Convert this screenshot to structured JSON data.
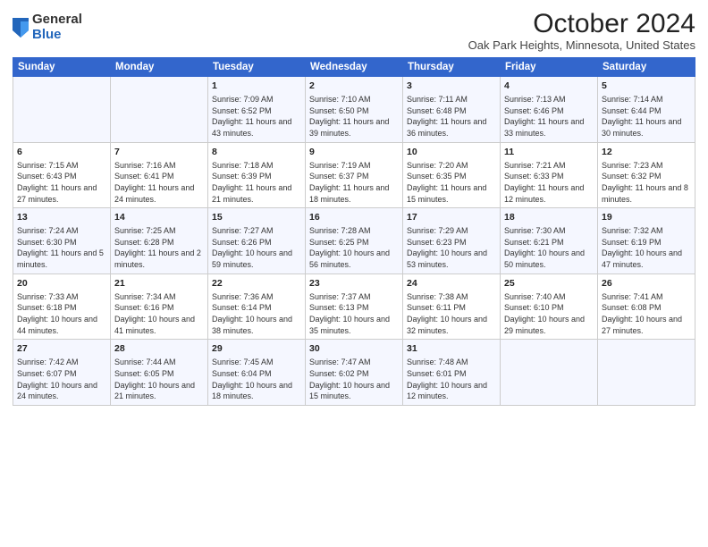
{
  "header": {
    "logo_general": "General",
    "logo_blue": "Blue",
    "title": "October 2024",
    "subtitle": "Oak Park Heights, Minnesota, United States"
  },
  "days_of_week": [
    "Sunday",
    "Monday",
    "Tuesday",
    "Wednesday",
    "Thursday",
    "Friday",
    "Saturday"
  ],
  "weeks": [
    [
      {
        "day": "",
        "data": ""
      },
      {
        "day": "",
        "data": ""
      },
      {
        "day": "1",
        "data": "Sunrise: 7:09 AM\nSunset: 6:52 PM\nDaylight: 11 hours and 43 minutes."
      },
      {
        "day": "2",
        "data": "Sunrise: 7:10 AM\nSunset: 6:50 PM\nDaylight: 11 hours and 39 minutes."
      },
      {
        "day": "3",
        "data": "Sunrise: 7:11 AM\nSunset: 6:48 PM\nDaylight: 11 hours and 36 minutes."
      },
      {
        "day": "4",
        "data": "Sunrise: 7:13 AM\nSunset: 6:46 PM\nDaylight: 11 hours and 33 minutes."
      },
      {
        "day": "5",
        "data": "Sunrise: 7:14 AM\nSunset: 6:44 PM\nDaylight: 11 hours and 30 minutes."
      }
    ],
    [
      {
        "day": "6",
        "data": "Sunrise: 7:15 AM\nSunset: 6:43 PM\nDaylight: 11 hours and 27 minutes."
      },
      {
        "day": "7",
        "data": "Sunrise: 7:16 AM\nSunset: 6:41 PM\nDaylight: 11 hours and 24 minutes."
      },
      {
        "day": "8",
        "data": "Sunrise: 7:18 AM\nSunset: 6:39 PM\nDaylight: 11 hours and 21 minutes."
      },
      {
        "day": "9",
        "data": "Sunrise: 7:19 AM\nSunset: 6:37 PM\nDaylight: 11 hours and 18 minutes."
      },
      {
        "day": "10",
        "data": "Sunrise: 7:20 AM\nSunset: 6:35 PM\nDaylight: 11 hours and 15 minutes."
      },
      {
        "day": "11",
        "data": "Sunrise: 7:21 AM\nSunset: 6:33 PM\nDaylight: 11 hours and 12 minutes."
      },
      {
        "day": "12",
        "data": "Sunrise: 7:23 AM\nSunset: 6:32 PM\nDaylight: 11 hours and 8 minutes."
      }
    ],
    [
      {
        "day": "13",
        "data": "Sunrise: 7:24 AM\nSunset: 6:30 PM\nDaylight: 11 hours and 5 minutes."
      },
      {
        "day": "14",
        "data": "Sunrise: 7:25 AM\nSunset: 6:28 PM\nDaylight: 11 hours and 2 minutes."
      },
      {
        "day": "15",
        "data": "Sunrise: 7:27 AM\nSunset: 6:26 PM\nDaylight: 10 hours and 59 minutes."
      },
      {
        "day": "16",
        "data": "Sunrise: 7:28 AM\nSunset: 6:25 PM\nDaylight: 10 hours and 56 minutes."
      },
      {
        "day": "17",
        "data": "Sunrise: 7:29 AM\nSunset: 6:23 PM\nDaylight: 10 hours and 53 minutes."
      },
      {
        "day": "18",
        "data": "Sunrise: 7:30 AM\nSunset: 6:21 PM\nDaylight: 10 hours and 50 minutes."
      },
      {
        "day": "19",
        "data": "Sunrise: 7:32 AM\nSunset: 6:19 PM\nDaylight: 10 hours and 47 minutes."
      }
    ],
    [
      {
        "day": "20",
        "data": "Sunrise: 7:33 AM\nSunset: 6:18 PM\nDaylight: 10 hours and 44 minutes."
      },
      {
        "day": "21",
        "data": "Sunrise: 7:34 AM\nSunset: 6:16 PM\nDaylight: 10 hours and 41 minutes."
      },
      {
        "day": "22",
        "data": "Sunrise: 7:36 AM\nSunset: 6:14 PM\nDaylight: 10 hours and 38 minutes."
      },
      {
        "day": "23",
        "data": "Sunrise: 7:37 AM\nSunset: 6:13 PM\nDaylight: 10 hours and 35 minutes."
      },
      {
        "day": "24",
        "data": "Sunrise: 7:38 AM\nSunset: 6:11 PM\nDaylight: 10 hours and 32 minutes."
      },
      {
        "day": "25",
        "data": "Sunrise: 7:40 AM\nSunset: 6:10 PM\nDaylight: 10 hours and 29 minutes."
      },
      {
        "day": "26",
        "data": "Sunrise: 7:41 AM\nSunset: 6:08 PM\nDaylight: 10 hours and 27 minutes."
      }
    ],
    [
      {
        "day": "27",
        "data": "Sunrise: 7:42 AM\nSunset: 6:07 PM\nDaylight: 10 hours and 24 minutes."
      },
      {
        "day": "28",
        "data": "Sunrise: 7:44 AM\nSunset: 6:05 PM\nDaylight: 10 hours and 21 minutes."
      },
      {
        "day": "29",
        "data": "Sunrise: 7:45 AM\nSunset: 6:04 PM\nDaylight: 10 hours and 18 minutes."
      },
      {
        "day": "30",
        "data": "Sunrise: 7:47 AM\nSunset: 6:02 PM\nDaylight: 10 hours and 15 minutes."
      },
      {
        "day": "31",
        "data": "Sunrise: 7:48 AM\nSunset: 6:01 PM\nDaylight: 10 hours and 12 minutes."
      },
      {
        "day": "",
        "data": ""
      },
      {
        "day": "",
        "data": ""
      }
    ]
  ]
}
